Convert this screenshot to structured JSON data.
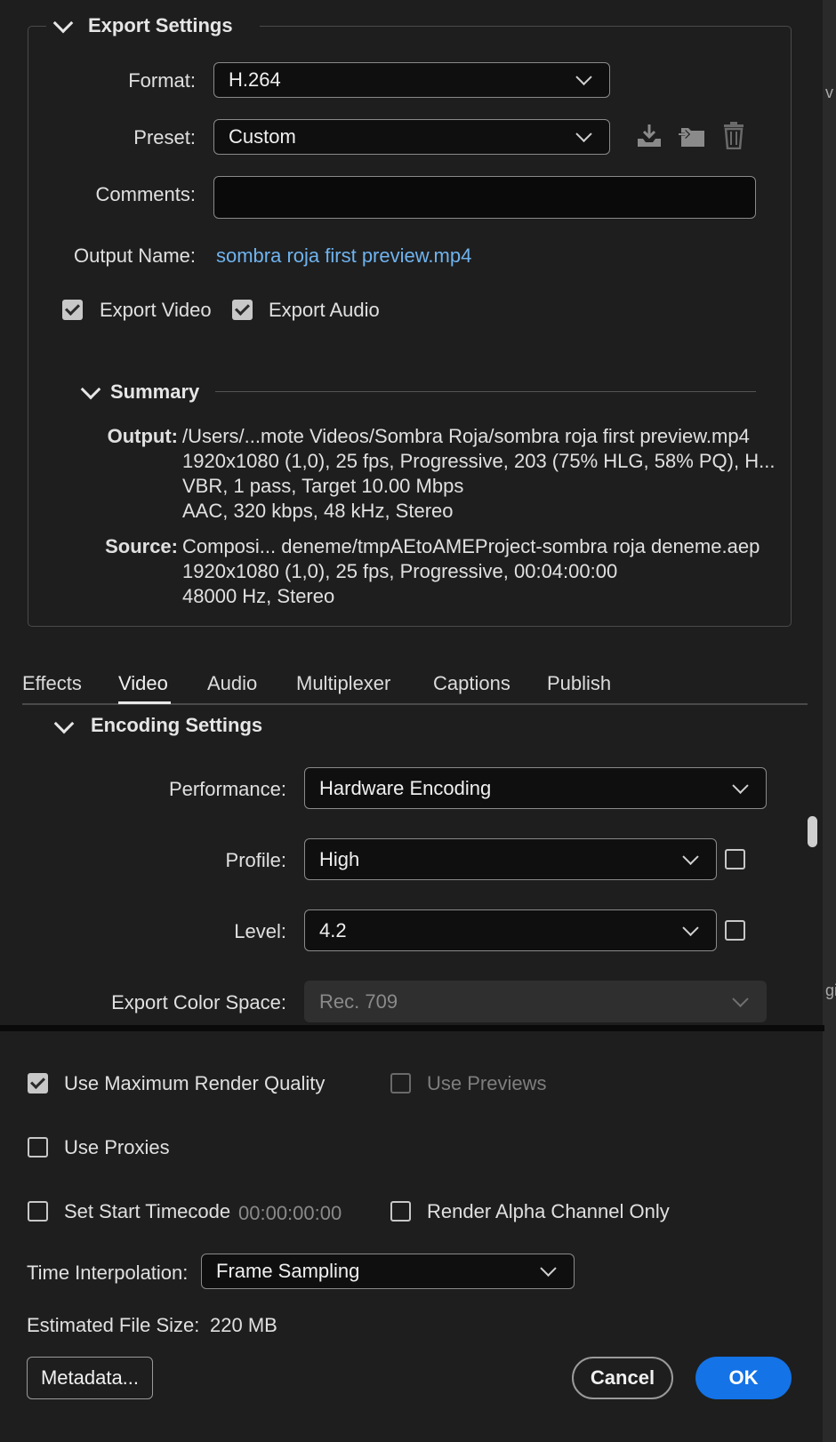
{
  "export_settings": {
    "title": "Export Settings",
    "format_label": "Format:",
    "format_value": "H.264",
    "preset_label": "Preset:",
    "preset_value": "Custom",
    "comments_label": "Comments:",
    "comments_value": "",
    "output_name_label": "Output Name:",
    "output_name_value": "sombra roja first preview.mp4",
    "export_video_label": "Export Video",
    "export_video_checked": true,
    "export_audio_label": "Export Audio",
    "export_audio_checked": true,
    "preset_icons": [
      "import-preset-icon",
      "save-preset-icon",
      "delete-preset-icon"
    ]
  },
  "summary": {
    "title": "Summary",
    "output_label": "Output:",
    "output_lines": [
      "/Users/...mote Videos/Sombra Roja/sombra roja first preview.mp4",
      "1920x1080 (1,0), 25 fps, Progressive, 203 (75% HLG, 58% PQ), H...",
      "VBR, 1 pass, Target 10.00 Mbps",
      "AAC, 320 kbps, 48 kHz, Stereo"
    ],
    "source_label": "Source:",
    "source_lines": [
      "Composi... deneme/tmpAEtoAMEProject-sombra roja deneme.aep",
      "1920x1080 (1,0), 25 fps, Progressive, 00:04:00:00",
      "48000 Hz, Stereo"
    ]
  },
  "tabs": [
    "Effects",
    "Video",
    "Audio",
    "Multiplexer",
    "Captions",
    "Publish"
  ],
  "active_tab": "Video",
  "encoding": {
    "title": "Encoding Settings",
    "performance_label": "Performance:",
    "performance_value": "Hardware Encoding",
    "profile_label": "Profile:",
    "profile_value": "High",
    "level_label": "Level:",
    "level_value": "4.2",
    "color_space_label": "Export Color Space:",
    "color_space_value": "Rec. 709"
  },
  "bottom": {
    "max_render_quality_label": "Use Maximum Render Quality",
    "max_render_quality_checked": true,
    "use_previews_label": "Use Previews",
    "use_previews_checked": false,
    "use_proxies_label": "Use Proxies",
    "use_proxies_checked": false,
    "set_start_timecode_label": "Set Start Timecode",
    "start_timecode_value": "00:00:00:00",
    "render_alpha_label": "Render Alpha Channel Only",
    "render_alpha_checked": false,
    "time_interp_label": "Time Interpolation:",
    "time_interp_value": "Frame Sampling",
    "est_size_label": "Estimated File Size:",
    "est_size_value": "220 MB",
    "metadata_button": "Metadata...",
    "cancel_button": "Cancel",
    "ok_button": "OK"
  },
  "edge_fragments": [
    "v",
    "gi"
  ],
  "colors": {
    "background": "#1e1e1e",
    "accent": "#1473e6",
    "link": "#6fb3ee"
  }
}
